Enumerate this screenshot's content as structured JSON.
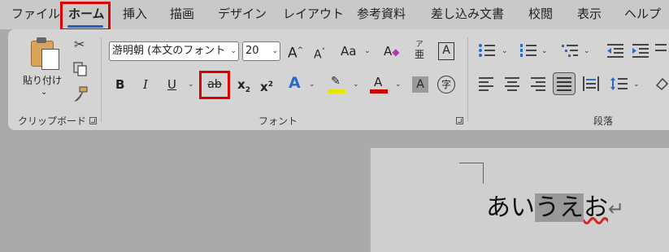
{
  "menu": {
    "tabs": [
      "ファイル",
      "ホーム",
      "挿入",
      "描画",
      "デザイン",
      "レイアウト",
      "参考資料",
      "差し込み文書",
      "校閲",
      "表示",
      "ヘルプ"
    ],
    "active": "ホーム"
  },
  "clipboard": {
    "paste_label": "貼り付け",
    "group_label": "クリップボード"
  },
  "font": {
    "font_name": "游明朝 (本文のフォント",
    "font_size": "20",
    "grow_label": "A",
    "shrink_label": "A",
    "case_label": "Aa",
    "phonetic_top": "ア",
    "phonetic_bottom": "亜",
    "border_char_label": "A",
    "bold_label": "B",
    "italic_label": "I",
    "underline_label": "U",
    "strike_label": "ab",
    "subscript_label": "x",
    "subscript_sub": "2",
    "superscript_label": "x",
    "superscript_sup": "2",
    "effects_label": "A",
    "font_color_label": "A",
    "shading_label": "A",
    "enclose_label": "字",
    "group_label": "フォント"
  },
  "paragraph": {
    "group_label": "段落"
  },
  "colors": {
    "highlight": "#e6e600",
    "font_color": "#d00000",
    "accent_blue": "#1f5fbf",
    "red_box": "#e00000"
  },
  "document": {
    "text_before": "あい",
    "text_selected": "うえ",
    "text_after": "お",
    "paragraph_mark": "↵"
  }
}
